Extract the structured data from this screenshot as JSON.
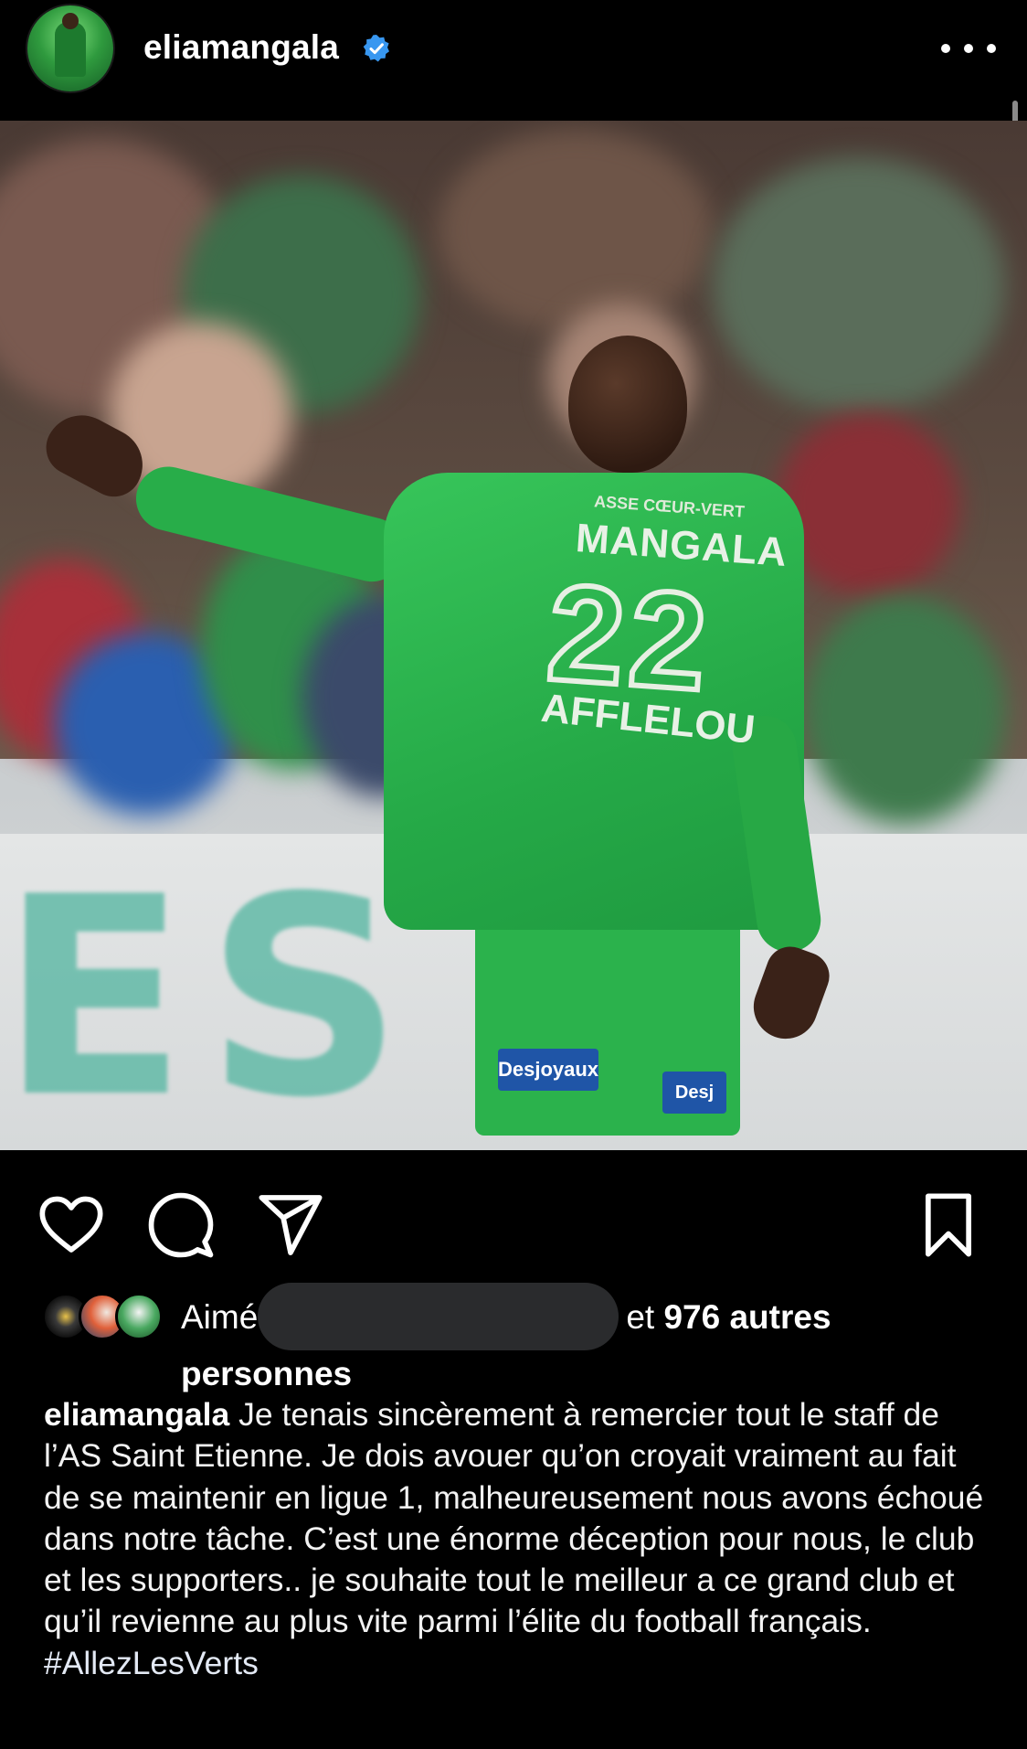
{
  "header": {
    "username": "eliamangala",
    "verified_icon": "verified-badge-icon",
    "more_icon": "more-options-icon"
  },
  "photo": {
    "jersey_club": "ASSE CŒUR-VERT",
    "jersey_name": "MANGALA",
    "jersey_number": "22",
    "jersey_sponsor": "AFFLELOU",
    "banner_text": "ES !",
    "shorts_sponsor": "Desjoyaux",
    "shorts_sponsor_short": "Desj"
  },
  "actions": {
    "like_icon": "heart-icon",
    "comment_icon": "comment-icon",
    "share_icon": "paper-plane-icon",
    "save_icon": "bookmark-icon"
  },
  "likes": {
    "prefix": "Aimé",
    "conjunction": "et",
    "count_text": "976 autres personnes"
  },
  "caption": {
    "username": "eliamangala",
    "text": "Je tenais sincèrement à remercier tout le staff de l’AS Saint Etienne. Je dois avouer qu’on croyait vraiment au fait de se maintenir en ligue 1, malheureusement nous avons échoué dans notre tâche. C’est une énorme déception pour nous, le club et les supporters.. je souhaite tout le meilleur a ce grand club et qu’il revienne au plus vite parmi l’élite du football français.",
    "hashtag": "#AllezLesVerts"
  },
  "colors": {
    "background": "#000000",
    "text": "#ffffff",
    "verified": "#3897f0",
    "redacted": "#2a2b2d"
  }
}
